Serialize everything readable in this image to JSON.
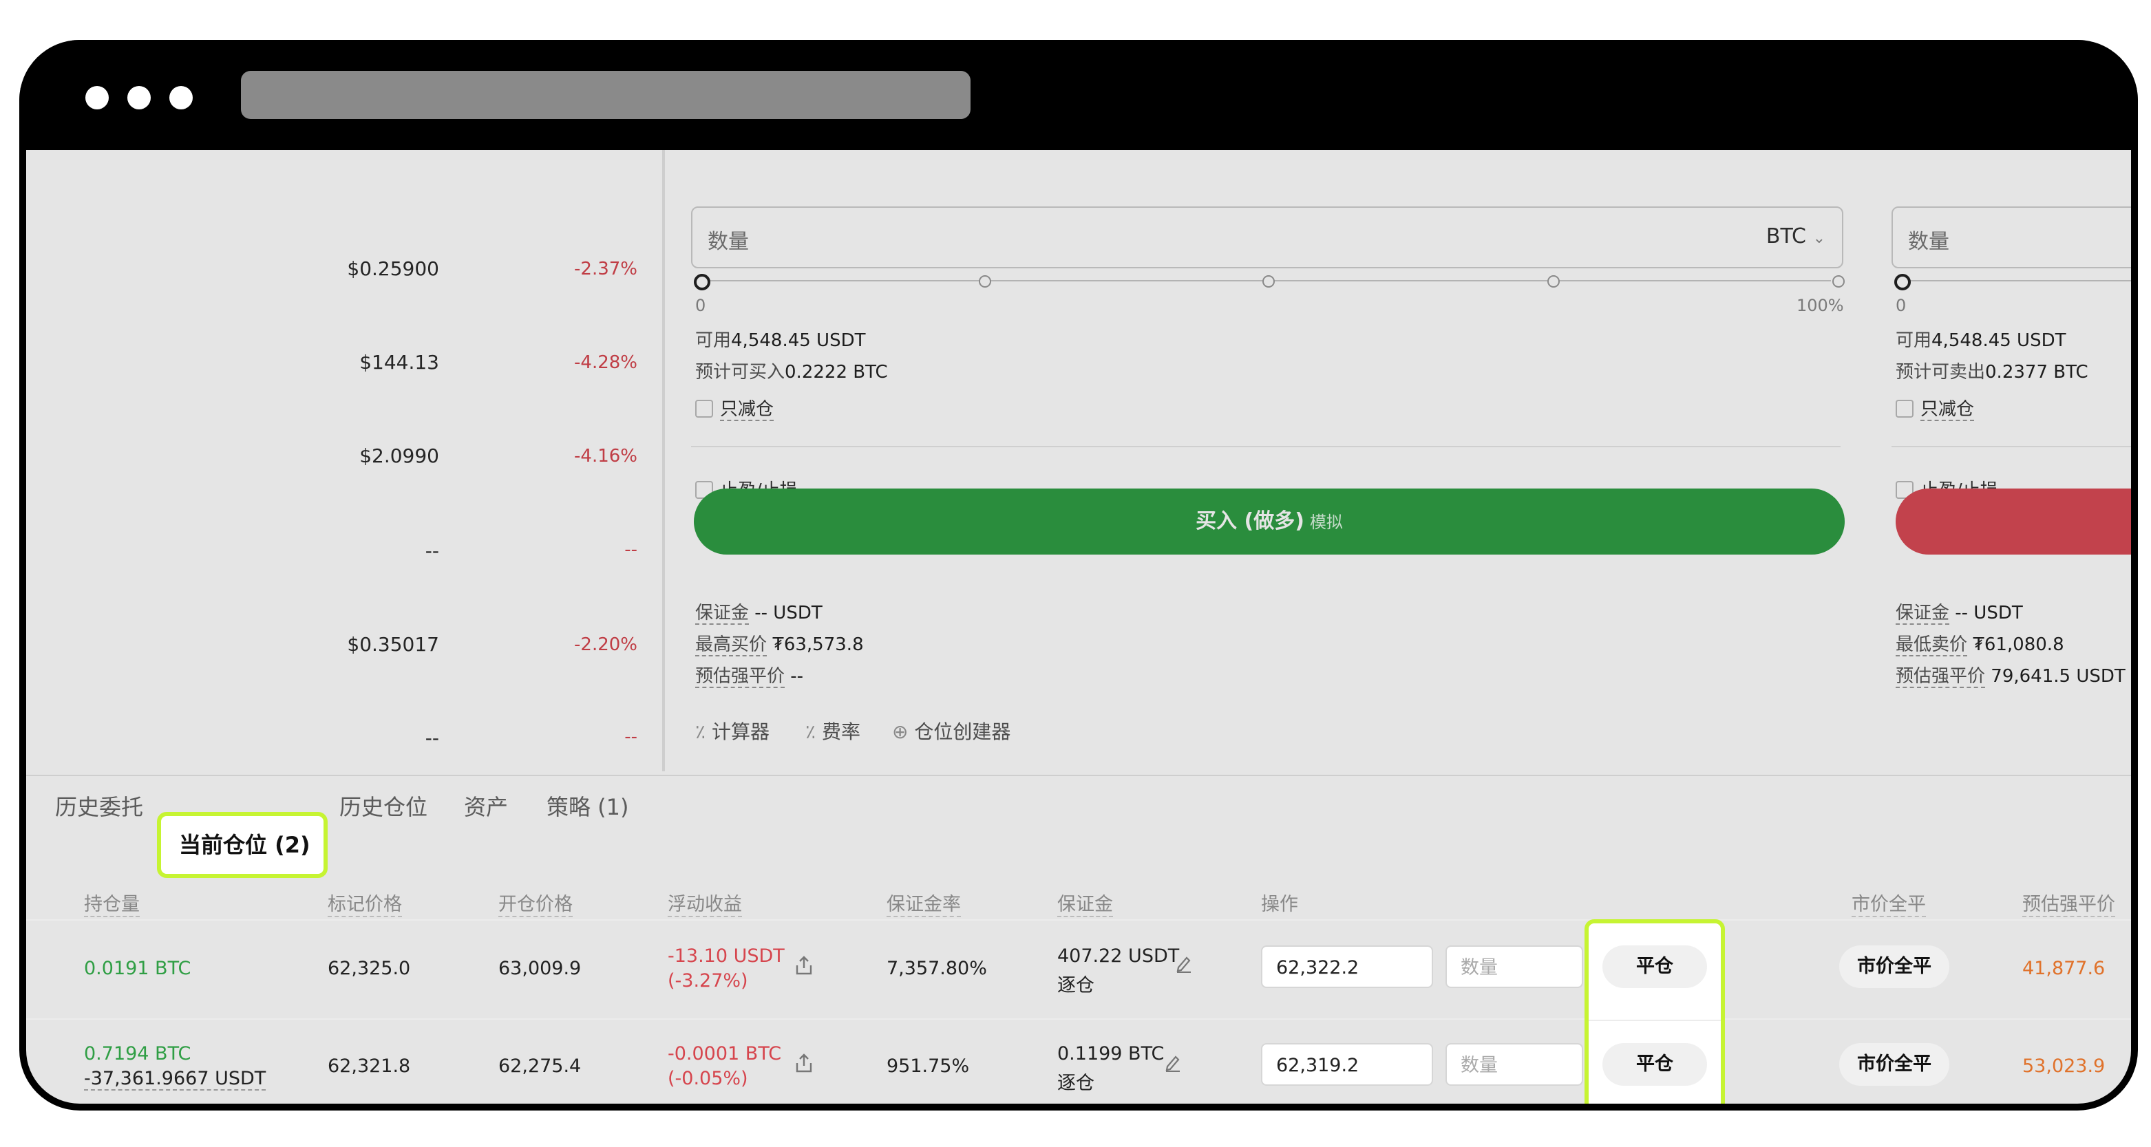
{
  "market": {
    "rows": [
      {
        "price": "$0.25900",
        "change": "-2.37%"
      },
      {
        "price": "$144.13",
        "change": "-4.28%"
      },
      {
        "price": "$2.0990",
        "change": "-4.16%"
      },
      {
        "price": "--",
        "change": "--"
      },
      {
        "price": "$0.35017",
        "change": "-2.20%"
      },
      {
        "price": "--",
        "change": "--"
      }
    ]
  },
  "buy_form": {
    "qty_label": "数量",
    "unit": "BTC",
    "slider_min": "0",
    "slider_max": "100%",
    "available_label": "可用",
    "available_value": "4,548.45 USDT",
    "est_label": "预计可买入",
    "est_value": "0.2222 BTC",
    "reduce_only": "只减仓",
    "tp_sl": "止盈/止损",
    "button_label": "买入 (做多)",
    "button_sub": "模拟",
    "margin_label": "保证金",
    "margin_value": "-- USDT",
    "max_price_label": "最高买价",
    "max_price_value": "₮63,573.8",
    "liq_label": "预估强平价",
    "liq_value": "--",
    "tool_calc": "计算器",
    "tool_fee": "费率",
    "tool_builder": "仓位创建器"
  },
  "sell_form": {
    "qty_label": "数量",
    "slider_min": "0",
    "available_label": "可用",
    "available_value": "4,548.45 USDT",
    "est_label": "预计可卖出",
    "est_value": "0.2377 BTC",
    "reduce_only": "只减仓",
    "tp_sl": "止盈/止损",
    "margin_label": "保证金",
    "margin_value": "-- USDT",
    "min_price_label": "最低卖价",
    "min_price_value": "₮61,080.8",
    "liq_label": "预估强平价",
    "liq_value": "79,641.5 USDT"
  },
  "tabs": [
    {
      "label": "历史委托"
    },
    {
      "label": "当前仓位 (2)"
    },
    {
      "label": "历史仓位"
    },
    {
      "label": "资产"
    },
    {
      "label": "策略 (1)"
    }
  ],
  "positions": {
    "headers": [
      "持仓量",
      "标记价格",
      "开仓价格",
      "浮动收益",
      "保证金率",
      "保证金",
      "操作",
      "市价全平",
      "预估强平价"
    ],
    "rows": [
      {
        "size": "0.0191 BTC",
        "size_sub": "",
        "mark": "62,325.0",
        "entry": "63,009.9",
        "pnl": "-13.10 USDT",
        "pnl_pct": "(-3.27%)",
        "margin_ratio": "7,357.80%",
        "margin": "407.22 USDT",
        "margin_mode": "逐仓",
        "price_input": "62,322.2",
        "qty_placeholder": "数量",
        "close_label": "平仓",
        "market_close_label": "市价全平",
        "liq_price": "41,877.6"
      },
      {
        "size": "0.7194 BTC",
        "size_sub": "-37,361.9667 USDT",
        "mark": "62,321.8",
        "entry": "62,275.4",
        "pnl": "-0.0001 BTC",
        "pnl_pct": "(-0.05%)",
        "margin_ratio": "951.75%",
        "margin": "0.1199 BTC",
        "margin_mode": "逐仓",
        "price_input": "62,319.2",
        "qty_placeholder": "数量",
        "close_label": "平仓",
        "market_close_label": "市价全平",
        "liq_price": "53,023.9"
      }
    ]
  },
  "colors": {
    "highlight": "#c6f432",
    "buy": "#2f9e44",
    "sell": "#d94a55",
    "negative": "#d6454d",
    "liq": "#e0722b"
  }
}
